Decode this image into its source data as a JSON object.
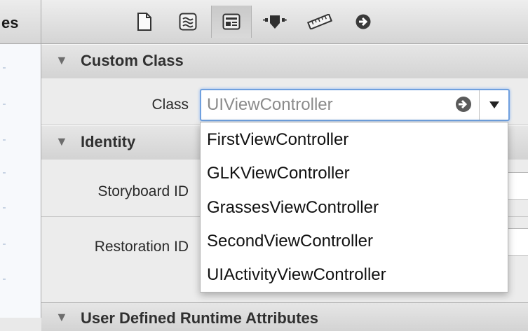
{
  "left_pane": {
    "label": "es"
  },
  "toolbar": {
    "tabs": [
      {
        "icon": "file-inspector-icon"
      },
      {
        "icon": "quick-help-icon"
      },
      {
        "icon": "identity-inspector-icon",
        "active": true
      },
      {
        "icon": "attributes-inspector-icon"
      },
      {
        "icon": "size-inspector-icon"
      },
      {
        "icon": "connections-inspector-icon"
      }
    ]
  },
  "custom_class": {
    "title": "Custom Class",
    "class_label": "Class",
    "class_value": "UIViewController"
  },
  "identity": {
    "title": "Identity",
    "storyboard_id_label": "Storyboard ID",
    "restoration_id_label": "Restoration ID"
  },
  "class_dropdown": {
    "options": [
      "FirstViewController",
      "GLKViewController",
      "GrassesViewController",
      "SecondViewController",
      "UIActivityViewController"
    ]
  },
  "user_defined": {
    "title": "User Defined Runtime Attributes"
  },
  "colors": {
    "focus_ring": "#6fa0df",
    "header_bg": "#dcdcdc"
  }
}
